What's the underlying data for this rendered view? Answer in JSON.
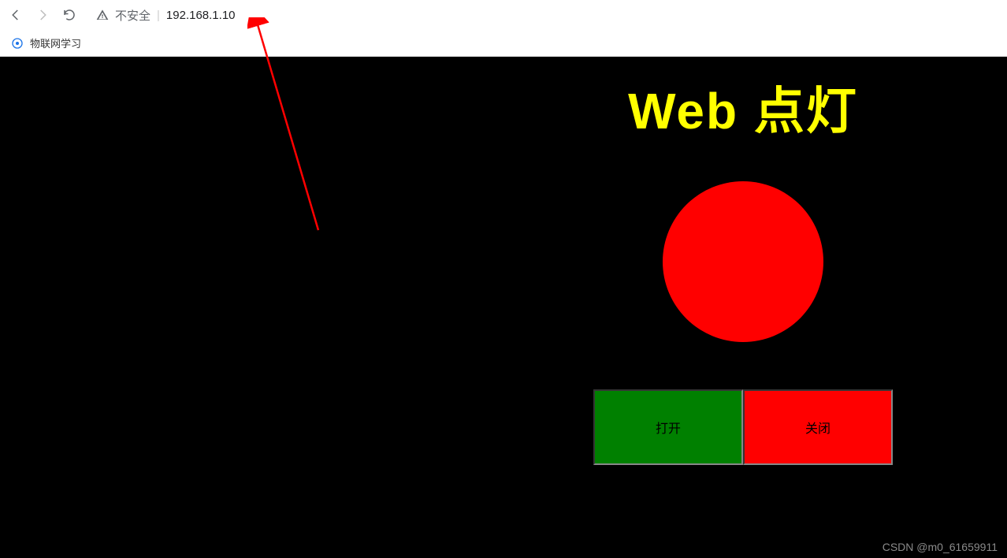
{
  "browser": {
    "not_secure_label": "不安全",
    "url": "192.168.1.10",
    "bookmark_label": "物联网学习"
  },
  "page": {
    "title": "Web 点灯",
    "led_color": "red",
    "buttons": {
      "open_label": "打开",
      "close_label": "关闭"
    }
  },
  "watermark": "CSDN @m0_61659911"
}
